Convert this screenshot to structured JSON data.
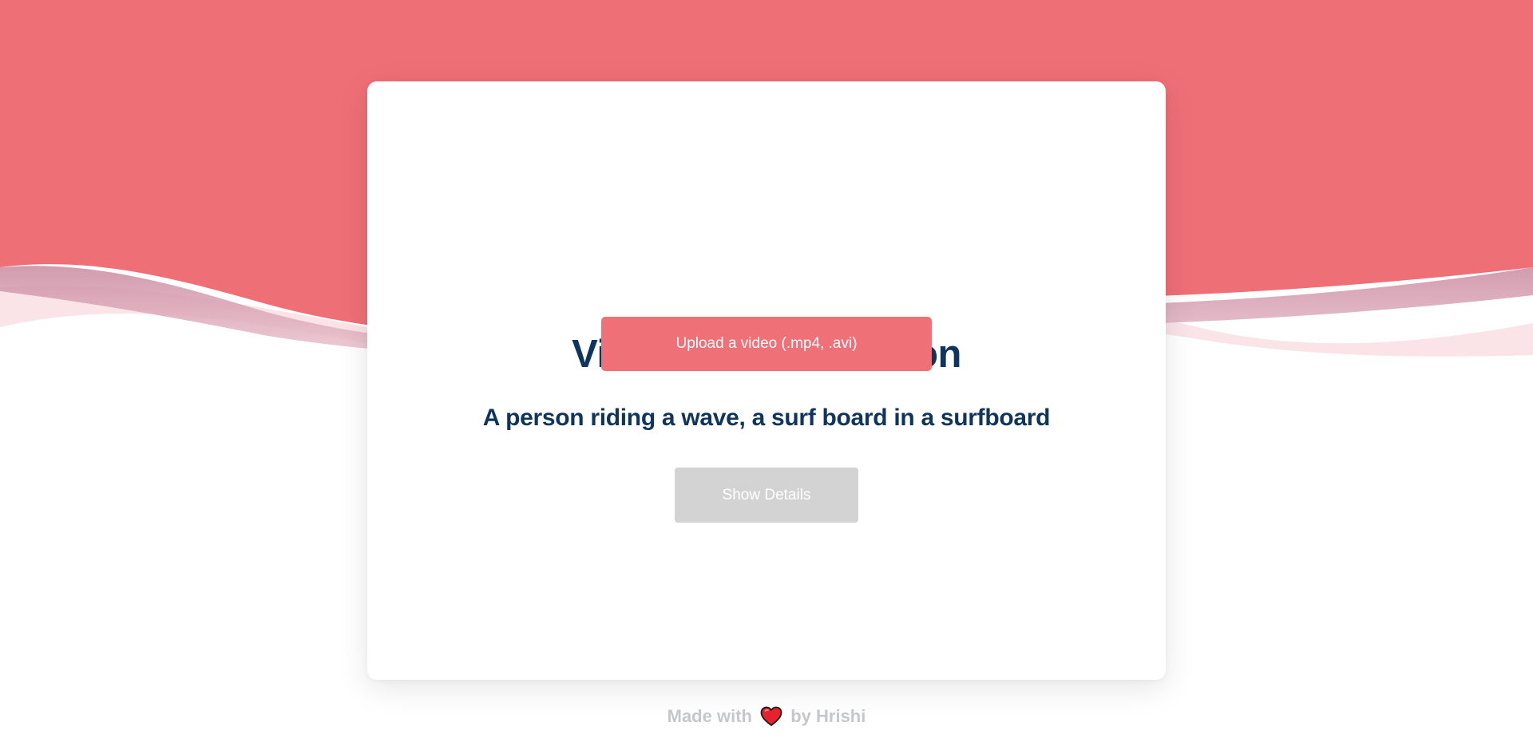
{
  "page": {
    "title": "Video Summarization",
    "upload_button_label": "Upload a video (.mp4, .avi)",
    "summary_caption": "A person riding a wave, a surf board in a surfboard",
    "details_button_label": "Show Details"
  },
  "footer": {
    "prefix": "Made with",
    "icon": "heart-icon",
    "suffix": "by Hrishi"
  },
  "colors": {
    "accent": "#ef7076",
    "heading": "#0f355e",
    "disabled_button": "#d3d3d3",
    "footer_text": "#c6c7cc",
    "heart": "#e8212d"
  }
}
